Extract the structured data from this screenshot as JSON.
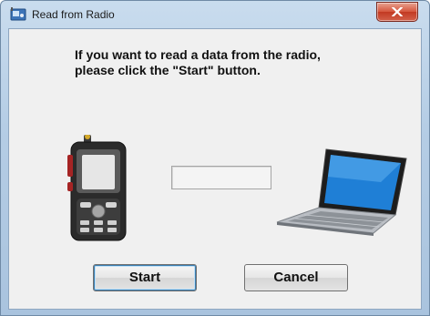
{
  "window": {
    "title": "Read from Radio",
    "icon": "radio-app-icon",
    "close_icon": "close-icon"
  },
  "dialog": {
    "instruction_line1": "If you want to read a data from the radio,",
    "instruction_line2": "please click the \"Start\" button.",
    "progress": 0,
    "radio_image": "handheld-radio-image",
    "laptop_image": "laptop-computer-image"
  },
  "buttons": {
    "start_label": "Start",
    "cancel_label": "Cancel"
  },
  "colors": {
    "close_button": "#c8432b",
    "dialog_background": "#f0f0f0",
    "title_bar": "#b9d1ea"
  }
}
